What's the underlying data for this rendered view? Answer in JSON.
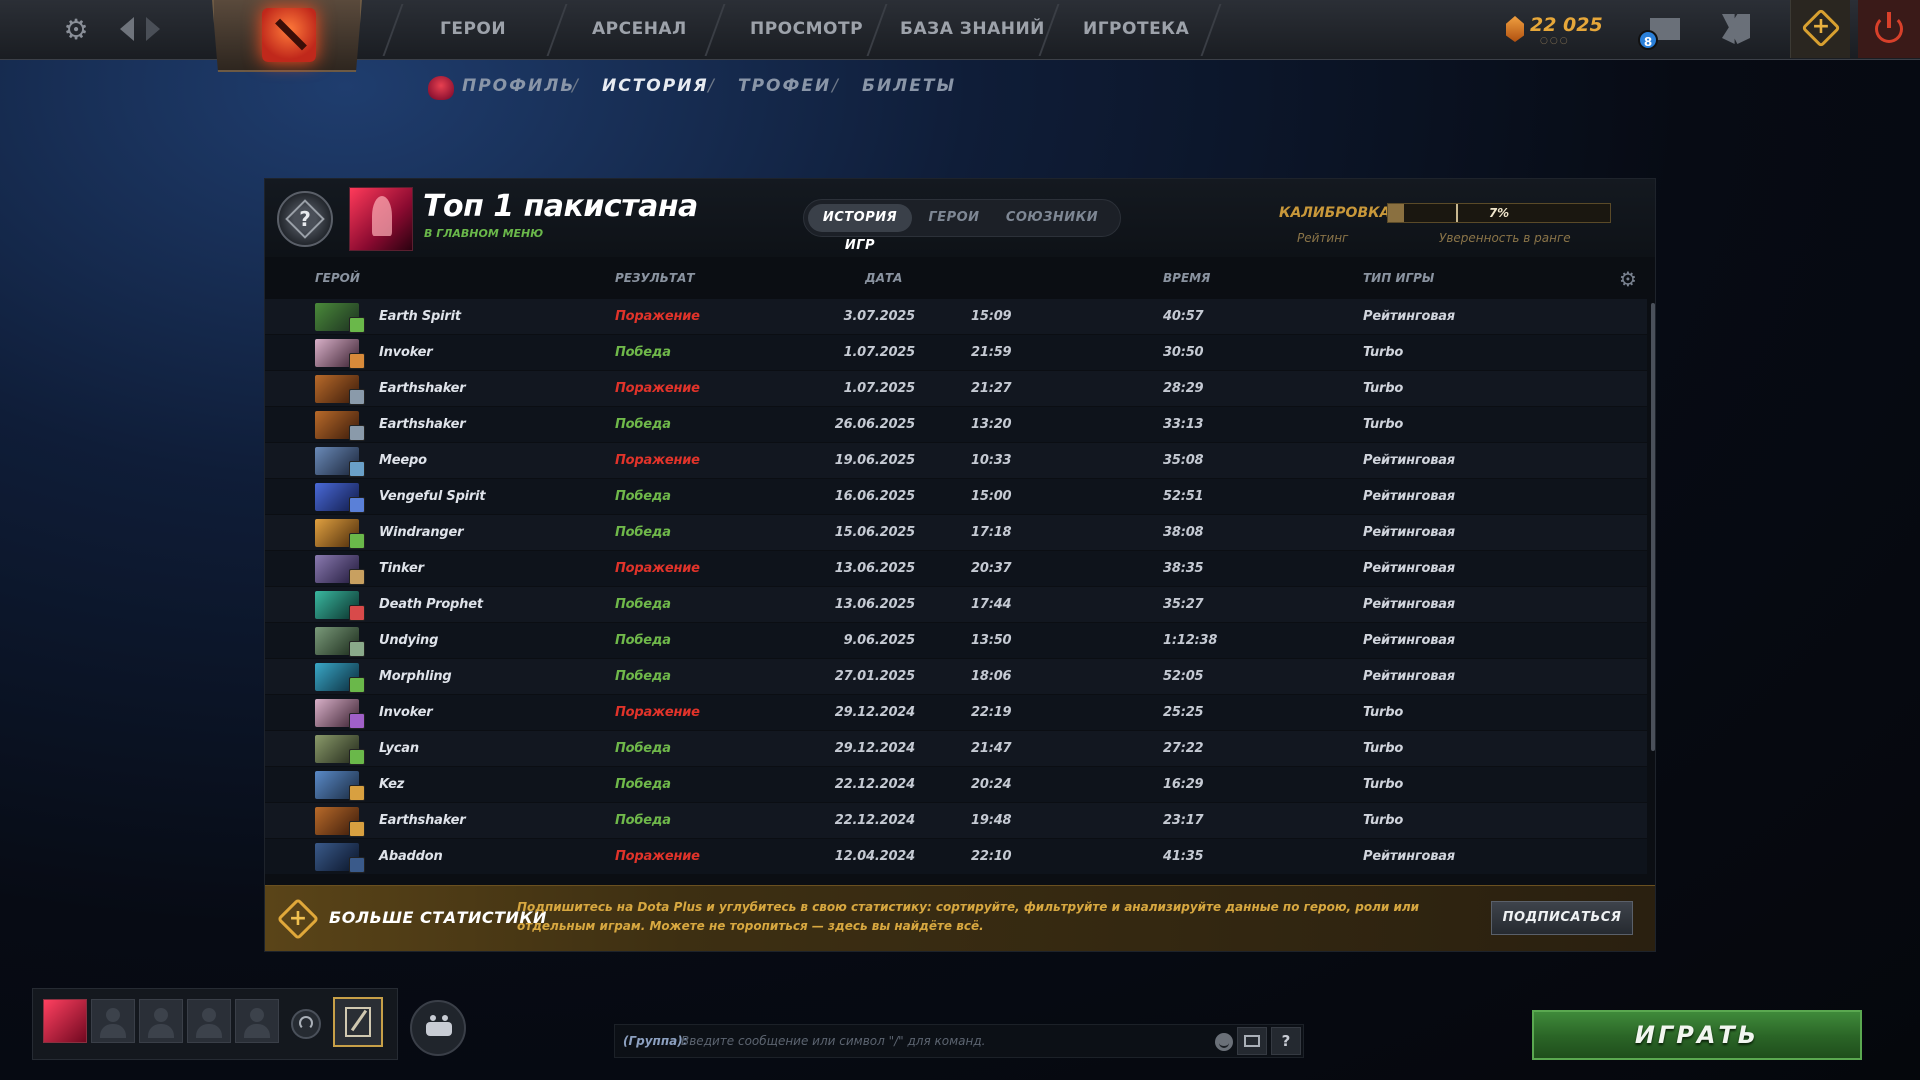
{
  "topbar": {
    "nav": [
      "ГЕРОИ",
      "АРСЕНАЛ",
      "ПРОСМОТР",
      "БАЗА ЗНАНИЙ",
      "ИГРОТЕКА"
    ],
    "currency": "22 025",
    "currency_dots": "○○○",
    "mail_count": "8",
    "icons": {
      "settings": "gear-icon",
      "back": "arrow-left-icon",
      "forward": "arrow-right-icon",
      "logo": "dota-logo-icon",
      "currency": "shard-icon",
      "mail": "mail-icon",
      "armory": "armory-icon",
      "dota_plus": "dota-plus-icon",
      "power": "power-icon"
    }
  },
  "subnav": {
    "items": [
      "ПРОФИЛЬ",
      "ИСТОРИЯ",
      "ТРОФЕИ",
      "БИЛЕТЫ"
    ],
    "active": "ИСТОРИЯ",
    "separator": "/"
  },
  "profile": {
    "rank_symbol": "?",
    "name": "Топ 1 пакистана",
    "status": "В ГЛАВНОМ МЕНЮ",
    "tabs": [
      "ИСТОРИЯ ИГР",
      "ГЕРОИ",
      "СОЮЗНИКИ"
    ],
    "active_tab": "ИСТОРИЯ ИГР",
    "calibration_label": "КАЛИБРОВКА",
    "rating_label": "Рейтинг",
    "confidence_value": "7%",
    "confidence_fraction": 0.07,
    "confidence_label": "Уверенность в ранге"
  },
  "table": {
    "headers": {
      "hero": "ГЕРОЙ",
      "result": "РЕЗУЛЬТАТ",
      "date": "ДАТА",
      "duration": "ВРЕМЯ",
      "mode": "ТИП ИГРЫ"
    },
    "rows": [
      {
        "hero": "Earth Spirit",
        "result": "Поражение",
        "win": false,
        "date": "3.07.2025",
        "time": "15:09",
        "duration": "40:57",
        "mode": "Рейтинговая",
        "c1": "#4a8a3a",
        "c2": "#1c3020",
        "badge": "#6ab84a"
      },
      {
        "hero": "Invoker",
        "result": "Победа",
        "win": true,
        "date": "1.07.2025",
        "time": "21:59",
        "duration": "30:50",
        "mode": "Turbo",
        "c1": "#d8b0c8",
        "c2": "#3a2030",
        "badge": "#d88a3a"
      },
      {
        "hero": "Earthshaker",
        "result": "Поражение",
        "win": false,
        "date": "1.07.2025",
        "time": "21:27",
        "duration": "28:29",
        "mode": "Turbo",
        "c1": "#b86a2a",
        "c2": "#3a1a0a",
        "badge": "#8a9aaa"
      },
      {
        "hero": "Earthshaker",
        "result": "Победа",
        "win": true,
        "date": "26.06.2025",
        "time": "13:20",
        "duration": "33:13",
        "mode": "Turbo",
        "c1": "#b86a2a",
        "c2": "#3a1a0a",
        "badge": "#8a9aaa"
      },
      {
        "hero": "Meepo",
        "result": "Поражение",
        "win": false,
        "date": "19.06.2025",
        "time": "10:33",
        "duration": "35:08",
        "mode": "Рейтинговая",
        "c1": "#6a8ab8",
        "c2": "#1a2438",
        "badge": "#6aa0c8"
      },
      {
        "hero": "Vengeful Spirit",
        "result": "Победа",
        "win": true,
        "date": "16.06.2025",
        "time": "15:00",
        "duration": "52:51",
        "mode": "Рейтинговая",
        "c1": "#4a6ad8",
        "c2": "#101a48",
        "badge": "#5a80d8"
      },
      {
        "hero": "Windranger",
        "result": "Победа",
        "win": true,
        "date": "15.06.2025",
        "time": "17:18",
        "duration": "38:08",
        "mode": "Рейтинговая",
        "c1": "#e0a040",
        "c2": "#4a2a0a",
        "badge": "#6ab84a"
      },
      {
        "hero": "Tinker",
        "result": "Поражение",
        "win": false,
        "date": "13.06.2025",
        "time": "20:37",
        "duration": "38:35",
        "mode": "Рейтинговая",
        "c1": "#8a7ab0",
        "c2": "#20183a",
        "badge": "#c8a060"
      },
      {
        "hero": "Death Prophet",
        "result": "Победа",
        "win": true,
        "date": "13.06.2025",
        "time": "17:44",
        "duration": "35:27",
        "mode": "Рейтинговая",
        "c1": "#3ab8a0",
        "c2": "#0a302a",
        "badge": "#d84a4a"
      },
      {
        "hero": "Undying",
        "result": "Победа",
        "win": true,
        "date": "9.06.2025",
        "time": "13:50",
        "duration": "1:12:38",
        "mode": "Рейтинговая",
        "c1": "#7a9a7a",
        "c2": "#1a2a1a",
        "badge": "#8aaa8a"
      },
      {
        "hero": "Morphling",
        "result": "Победа",
        "win": true,
        "date": "27.01.2025",
        "time": "18:06",
        "duration": "52:05",
        "mode": "Рейтинговая",
        "c1": "#3aa8c8",
        "c2": "#0a2a3a",
        "badge": "#6ab84a"
      },
      {
        "hero": "Invoker",
        "result": "Поражение",
        "win": false,
        "date": "29.12.2024",
        "time": "22:19",
        "duration": "25:25",
        "mode": "Turbo",
        "c1": "#d8b0c8",
        "c2": "#3a2030",
        "badge": "#a060c8"
      },
      {
        "hero": "Lycan",
        "result": "Победа",
        "win": true,
        "date": "29.12.2024",
        "time": "21:47",
        "duration": "27:22",
        "mode": "Turbo",
        "c1": "#8a9a6a",
        "c2": "#22281a",
        "badge": "#6ab84a"
      },
      {
        "hero": "Kez",
        "result": "Победа",
        "win": true,
        "date": "22.12.2024",
        "time": "20:24",
        "duration": "16:29",
        "mode": "Turbo",
        "c1": "#5a8ac8",
        "c2": "#1a2a40",
        "badge": "#d8a040"
      },
      {
        "hero": "Earthshaker",
        "result": "Победа",
        "win": true,
        "date": "22.12.2024",
        "time": "19:48",
        "duration": "23:17",
        "mode": "Turbo",
        "c1": "#b86a2a",
        "c2": "#3a1a0a",
        "badge": "#d8a040"
      },
      {
        "hero": "Abaddon",
        "result": "Поражение",
        "win": false,
        "date": "12.04.2024",
        "time": "22:10",
        "duration": "41:35",
        "mode": "Рейтинговая",
        "c1": "#3a5a8a",
        "c2": "#0a1428",
        "badge": "#3a5a8a"
      }
    ]
  },
  "promo": {
    "title": "БОЛЬШЕ СТАТИСТИКИ",
    "text": "Подпишитесь на Dota Plus и углубитесь в свою статистику: сортируйте, фильтруйте и анализируйте данные по герою, роли или отдельным играм. Можете не торопиться — здесь вы найдёте всё.",
    "button": "ПОДПИСАТЬСЯ",
    "icon": "dota-plus-icon"
  },
  "bottom": {
    "chat_channel": "(Группа):",
    "chat_placeholder": "Введите сообщение или символ \"/\" для команд.",
    "help_label": "?",
    "play_label": "ИГРАТЬ",
    "icons": {
      "voice": "headset-icon",
      "battlepass": "battlepass-icon",
      "friends": "friends-icon",
      "emoji": "smiley-icon",
      "image": "image-icon"
    }
  }
}
